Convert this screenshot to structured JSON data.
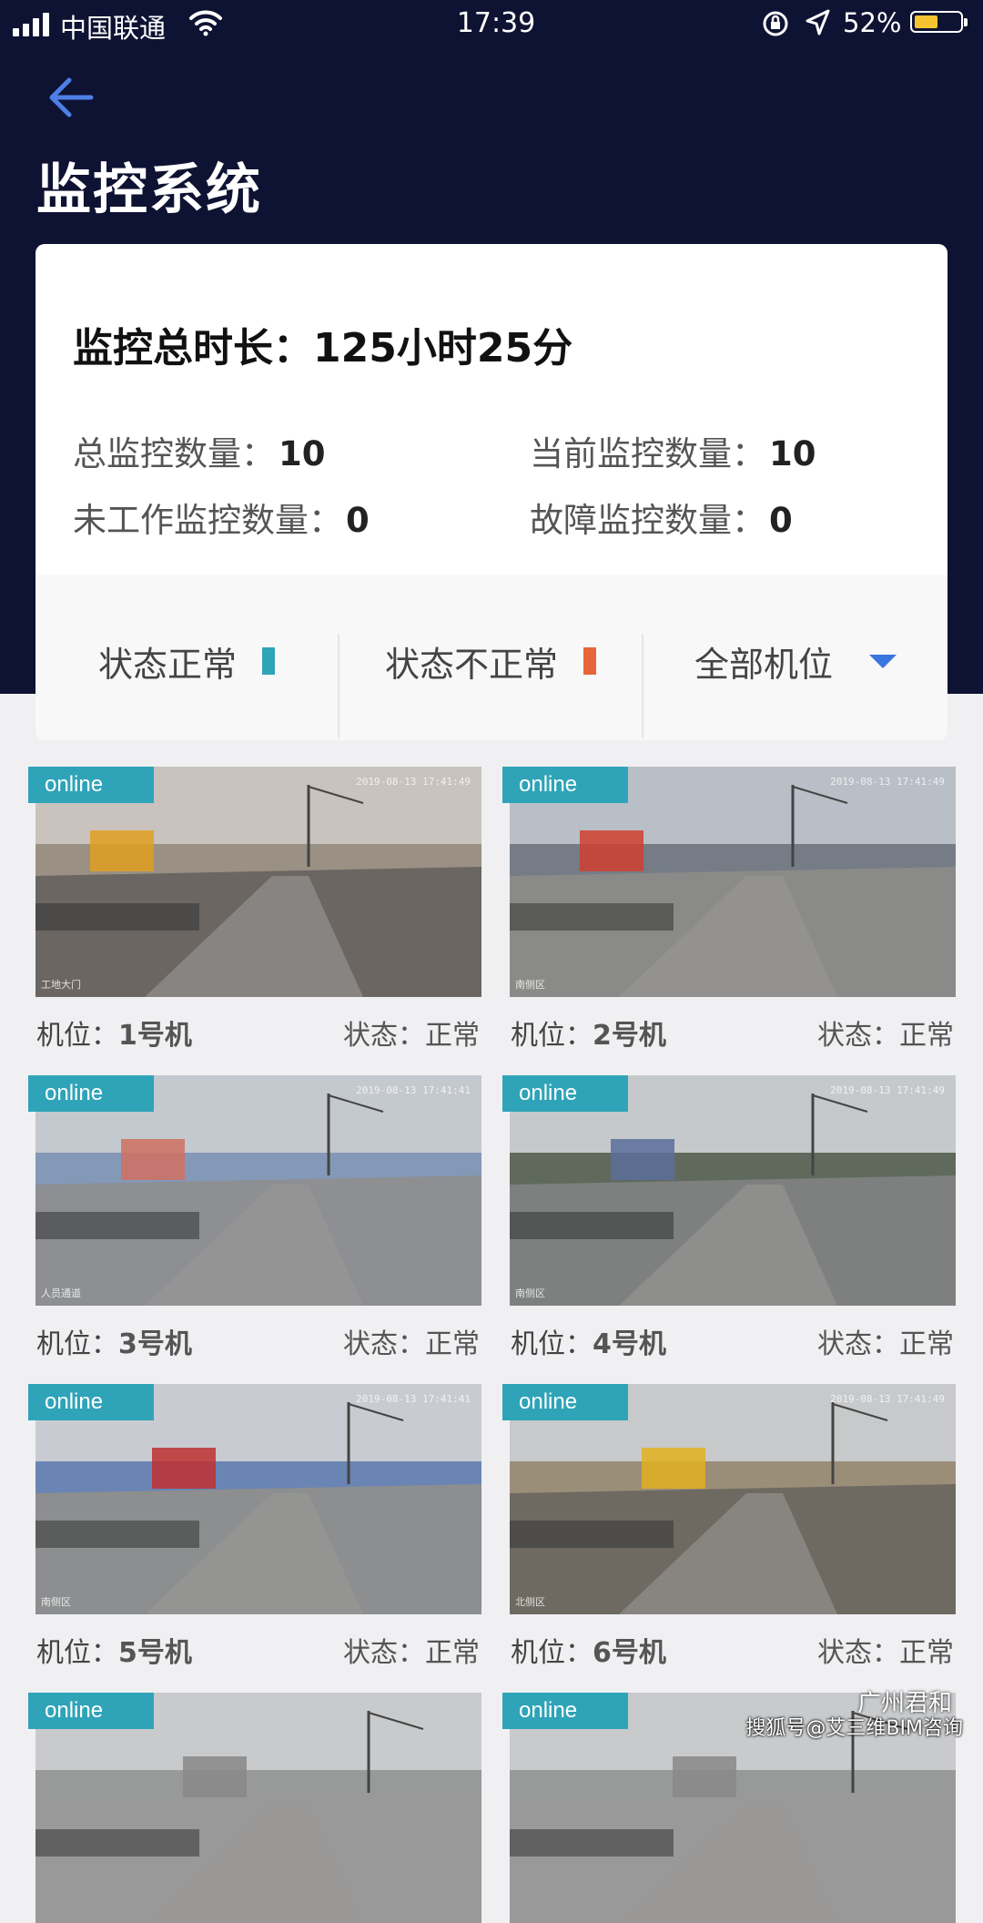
{
  "status_bar": {
    "carrier": "中国联通",
    "time": "17:39",
    "battery_pct": "52%",
    "battery_level": 0.52
  },
  "header": {
    "title": "监控系统"
  },
  "summary": {
    "total_duration_label": "监控总时长：",
    "total_duration_value": "125小时25分",
    "total_count_label": "总监控数量：",
    "total_count_value": "10",
    "current_count_label": "当前监控数量：",
    "current_count_value": "10",
    "idle_count_label": "未工作监控数量：",
    "idle_count_value": "0",
    "fault_count_label": "故障监控数量：",
    "fault_count_value": "0"
  },
  "filters": {
    "normal_label": "状态正常",
    "abnormal_label": "状态不正常",
    "all_positions_label": "全部机位",
    "normal_color": "#2fa4b8",
    "abnormal_color": "#e8653a",
    "dropdown_color": "#3a76e0"
  },
  "cameras": [
    {
      "badge": "online",
      "timestamp": "2019-08-13 17:41:49",
      "location": "工地大门",
      "position_label": "机位：",
      "position": "1号机",
      "status_label": "状态：",
      "status": "正常"
    },
    {
      "badge": "online",
      "timestamp": "2019-08-13 17:41:49",
      "location": "南侧区",
      "position_label": "机位：",
      "position": "2号机",
      "status_label": "状态：",
      "status": "正常"
    },
    {
      "badge": "online",
      "timestamp": "2019-08-13 17:41:41",
      "location": "人员通道",
      "position_label": "机位：",
      "position": "3号机",
      "status_label": "状态：",
      "status": "正常"
    },
    {
      "badge": "online",
      "timestamp": "2019-08-13 17:41:49",
      "location": "南侧区",
      "position_label": "机位：",
      "position": "4号机",
      "status_label": "状态：",
      "status": "正常"
    },
    {
      "badge": "online",
      "timestamp": "2019-08-13 17:41:41",
      "location": "南侧区",
      "position_label": "机位：",
      "position": "5号机",
      "status_label": "状态：",
      "status": "正常"
    },
    {
      "badge": "online",
      "timestamp": "2019-08-13 17:41:49",
      "location": "北侧区",
      "position_label": "机位：",
      "position": "6号机",
      "status_label": "状态：",
      "status": "正常"
    },
    {
      "badge": "online",
      "timestamp": "",
      "location": "",
      "position_label": "",
      "position": "",
      "status_label": "",
      "status": ""
    },
    {
      "badge": "online",
      "timestamp": "",
      "location": "",
      "position_label": "",
      "position": "",
      "status_label": "",
      "status": ""
    }
  ],
  "watermark": {
    "line1": "广州君和",
    "line2": "搜狐号@艾三维BIM咨询"
  }
}
